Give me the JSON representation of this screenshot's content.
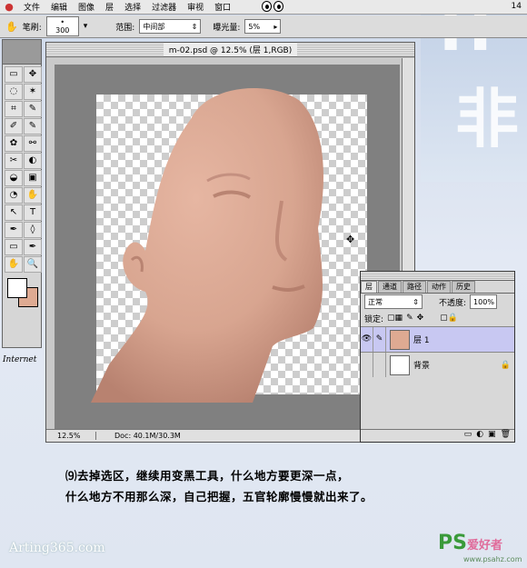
{
  "menubar": {
    "items": [
      "文件",
      "编辑",
      "图像",
      "层",
      "选择",
      "过滤器",
      "审视",
      "窗口"
    ],
    "clock": "14"
  },
  "options": {
    "brush_label": "笔刷:",
    "brush_size": "300",
    "range_label": "范围:",
    "range_value": "中间部",
    "exposure_label": "曝光量:",
    "exposure_value": "5%"
  },
  "document": {
    "title": "m-02.psd @ 12.5% (层 1,RGB)",
    "zoom": "12.5%",
    "doc_size": "Doc: 40.1M/30.3M"
  },
  "toolbox": {
    "tools": [
      "▭",
      "✥",
      "◌",
      "✶",
      "⌗",
      "✎",
      "✐",
      "✎",
      "✿",
      "⚯",
      "✂",
      "◐",
      "◒",
      "▣",
      "◔",
      "✋",
      "↖",
      "T",
      "✒",
      "◊",
      "▭",
      "✒",
      "✋",
      "🔍"
    ]
  },
  "layers_panel": {
    "tabs": [
      "层",
      "通道",
      "路径",
      "动作",
      "历史"
    ],
    "mode": "正常",
    "opacity_label": "不透度:",
    "opacity_value": "100%",
    "lock_label": "锁定:",
    "layers": [
      {
        "name": "层 1",
        "selected": true
      },
      {
        "name": "背景",
        "selected": false
      }
    ]
  },
  "desktop": {
    "internet_label": "Internet"
  },
  "caption": {
    "line1": "⑼去掉选区，继续用变黑工具，什么地方要更深一点，",
    "line2": "什么地方不用那么深，自己把握，五官轮廓慢慢就出来了。"
  },
  "watermarks": {
    "site": "Arting365.com",
    "ps_brand": "PS",
    "ps_text": "爱好者",
    "ps_url": "www.psahz.com"
  },
  "colors": {
    "skin": "#deaa92",
    "selected_layer": "#c8c8f2"
  }
}
